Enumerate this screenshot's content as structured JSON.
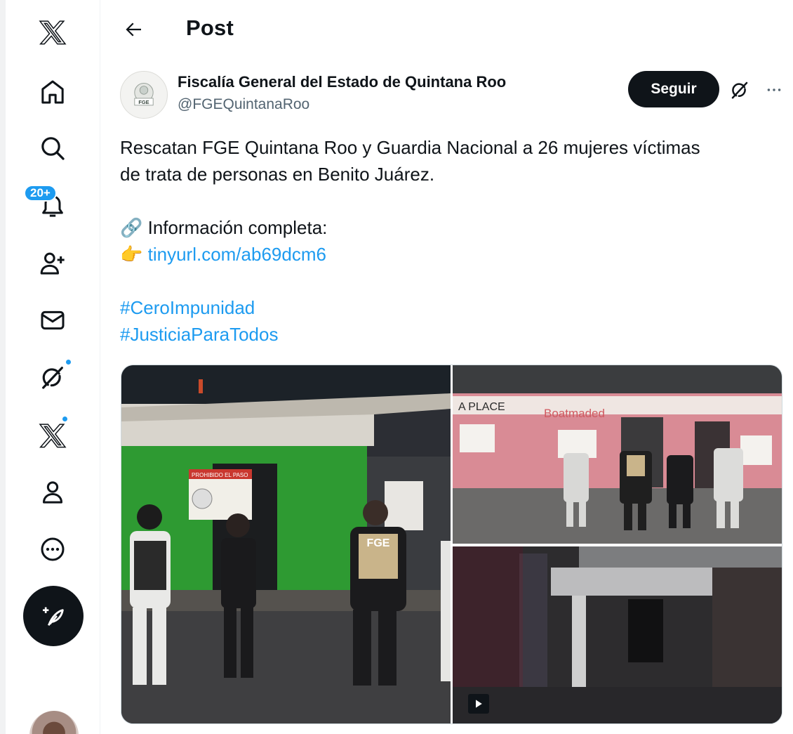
{
  "sidebar": {
    "notifications_badge": "20+",
    "items": [
      {
        "name": "x-logo",
        "icon": "x-logo-icon"
      },
      {
        "name": "home",
        "icon": "home-icon"
      },
      {
        "name": "explore",
        "icon": "search-icon"
      },
      {
        "name": "notifications",
        "icon": "bell-icon"
      },
      {
        "name": "follow",
        "icon": "person-add-icon"
      },
      {
        "name": "messages",
        "icon": "mail-icon"
      },
      {
        "name": "grok",
        "icon": "grok-icon"
      },
      {
        "name": "premium",
        "icon": "x-logo-icon"
      },
      {
        "name": "profile",
        "icon": "person-icon"
      },
      {
        "name": "more",
        "icon": "more-circle-icon"
      }
    ]
  },
  "header": {
    "back_icon": "arrow-left-icon",
    "title": "Post"
  },
  "tweet": {
    "author_name": "Fiscalía General del Estado de Quintana Roo",
    "author_handle": "@FGEQuintanaRoo",
    "avatar_label": "FGE",
    "follow_label": "Seguir",
    "text_line1": "Rescatan FGE Quintana Roo y Guardia Nacional a 26 mujeres víctimas",
    "text_line2": "de trata de personas en Benito Juárez.",
    "link_emoji": "🔗",
    "info_label": "Información completa:",
    "point_emoji": "👉",
    "link_url": "tinyurl.com/ab69dcm6",
    "hashtag1": "#CeroImpunidad",
    "hashtag2": "#JusticiaParaTodos",
    "photo_text": {
      "sign1": "PROHIBIDO EL PASO",
      "vest": "FGE",
      "store_sign": "A PLACE",
      "store_sign2": "Boatmaded"
    }
  },
  "colors": {
    "accent": "#1d9bf0",
    "text": "#0f1419",
    "secondary": "#536471"
  }
}
